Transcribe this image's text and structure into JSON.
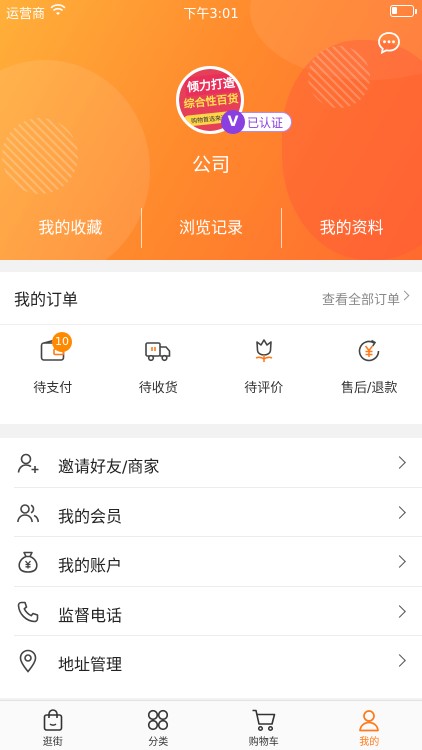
{
  "status_bar": {
    "carrier": "运营商",
    "time": "下午3:01"
  },
  "header": {
    "avatar_text": {
      "line1": "倾力打造",
      "line2": "综合性百货",
      "line3": "购物首选来这里"
    },
    "verified_label": "已认证",
    "verified_mark": "V",
    "company_name": "公司",
    "tabs": [
      {
        "label": "我的收藏"
      },
      {
        "label": "浏览记录"
      },
      {
        "label": "我的资料"
      }
    ]
  },
  "orders": {
    "title": "我的订单",
    "view_all": "查看全部订单",
    "items": [
      {
        "label": "待支付",
        "icon": "wallet-icon",
        "badge": "10"
      },
      {
        "label": "待收货",
        "icon": "truck-icon"
      },
      {
        "label": "待评价",
        "icon": "flower-icon"
      },
      {
        "label": "售后/退款",
        "icon": "refund-icon"
      }
    ]
  },
  "menu": [
    {
      "label": "邀请好友/商家",
      "icon": "user-add-icon"
    },
    {
      "label": "我的会员",
      "icon": "members-icon"
    },
    {
      "label": "我的账户",
      "icon": "money-bag-icon"
    },
    {
      "label": "监督电话",
      "icon": "phone-icon"
    },
    {
      "label": "地址管理",
      "icon": "location-icon"
    }
  ],
  "tabbar": {
    "items": [
      {
        "label": "逛街",
        "icon": "bag-icon"
      },
      {
        "label": "分类",
        "icon": "grid-icon"
      },
      {
        "label": "购物车",
        "icon": "cart-icon"
      },
      {
        "label": "我的",
        "icon": "person-icon",
        "active": true
      }
    ]
  },
  "colors": {
    "accent": "#ff7a1a",
    "header_start": "#ffb03a",
    "header_end": "#ff6a2e",
    "badge": "#ff8a00",
    "verified": "#8a3fe0"
  }
}
